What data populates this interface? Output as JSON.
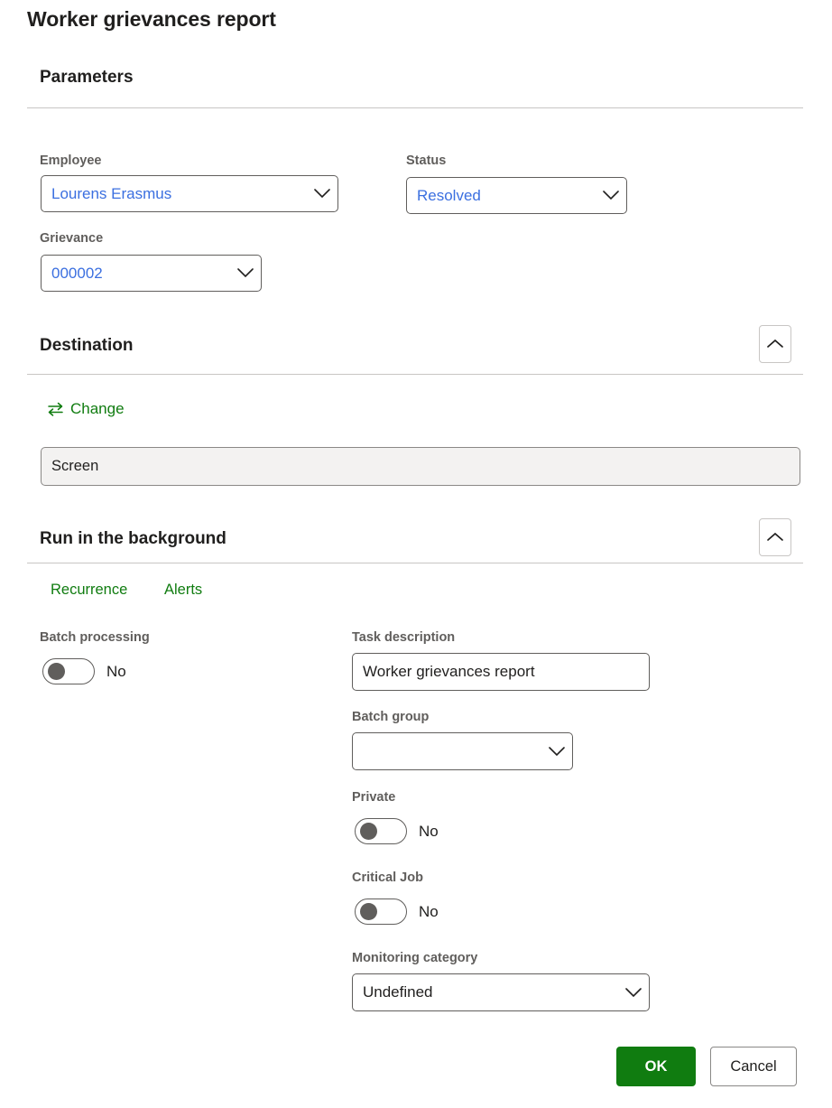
{
  "dialog": {
    "title": "Worker grievances report"
  },
  "sections": {
    "parameters": {
      "heading": "Parameters",
      "fields": {
        "employee": {
          "label": "Employee",
          "value": "Lourens Erasmus"
        },
        "status": {
          "label": "Status",
          "value": "Resolved"
        },
        "grievance": {
          "label": "Grievance",
          "value": "000002"
        }
      }
    },
    "destination": {
      "heading": "Destination",
      "change_label": "Change",
      "change_icon": "swap-arrows-icon",
      "collapse_icon": "chevron-up-icon",
      "value": "Screen"
    },
    "background": {
      "heading": "Run in the background",
      "collapse_icon": "chevron-up-icon",
      "tabs": [
        {
          "label": "Recurrence"
        },
        {
          "label": "Alerts"
        }
      ],
      "fields": {
        "batch_processing": {
          "label": "Batch processing",
          "value": "No",
          "on": false
        },
        "task_description": {
          "label": "Task description",
          "value": "Worker grievances report"
        },
        "batch_group": {
          "label": "Batch group",
          "value": "",
          "placeholder": ""
        },
        "private": {
          "label": "Private",
          "value": "No",
          "on": false
        },
        "critical_job": {
          "label": "Critical Job",
          "value": "No",
          "on": false
        },
        "monitoring_category": {
          "label": "Monitoring category",
          "value": "Undefined"
        }
      }
    }
  },
  "footer": {
    "ok_label": "OK",
    "cancel_label": "Cancel"
  },
  "colors": {
    "accent_green": "#107c10",
    "link_blue": "#3b6fe0",
    "label_gray": "#605e5c",
    "divider_gray": "#c8c6c4",
    "readonly_bg": "#f3f2f1"
  }
}
